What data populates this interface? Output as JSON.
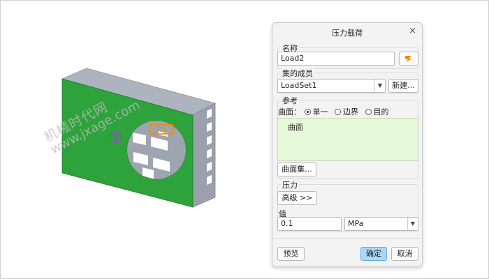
{
  "dialog": {
    "title": "压力载荷",
    "close_symbol": "×",
    "name_label": "名称",
    "name_value": "Load2",
    "member_label": "集的成员",
    "member_value": "LoadSet1",
    "new_button": "新建...",
    "ref_label": "参考",
    "surface_label": "曲面：",
    "radio_options": [
      {
        "label": "单一",
        "selected": true
      },
      {
        "label": "边界",
        "selected": false
      },
      {
        "label": "目的",
        "selected": false
      }
    ],
    "collector_item": "曲面",
    "surface_set_button": "曲面集...",
    "pressure_label": "压力",
    "advanced_button": "高级 >>",
    "value_label": "值",
    "value": "0.1",
    "unit": "MPa",
    "preview_button": "预览",
    "ok_button": "确定",
    "cancel_button": "取消"
  },
  "watermark": {
    "line1": "机械时代网",
    "line2": "www.jxage.com"
  },
  "colors": {
    "model_face": "#2ea33c",
    "model_side": "#9aa1ad",
    "model_top": "#aeb4bf",
    "collector_bg": "#e6f9d9",
    "primary_button": "#a9d9f6",
    "icon_orange": "#f08a00",
    "csys_purple": "#a040d0"
  }
}
